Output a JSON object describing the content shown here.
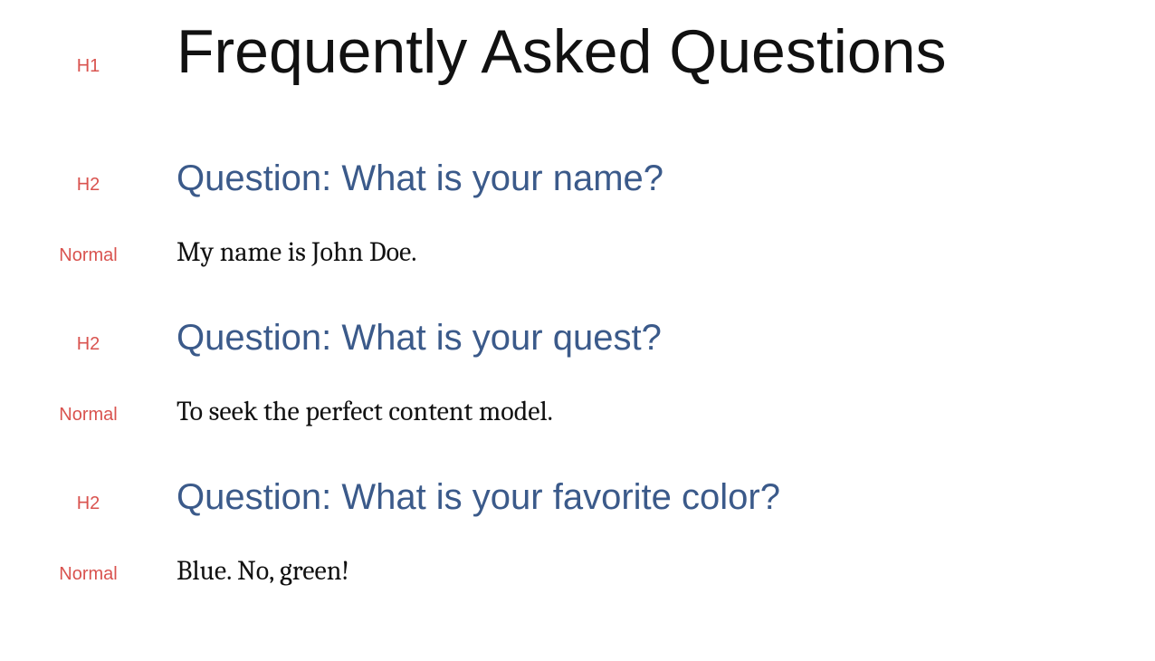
{
  "labels": {
    "h1": "H1",
    "h2": "H2",
    "normal": "Normal"
  },
  "title": "Frequently Asked Questions",
  "faq": [
    {
      "question": "Question: What is your name?",
      "answer": "My name is John Doe."
    },
    {
      "question": "Question: What is your quest?",
      "answer": "To seek the perfect content model."
    },
    {
      "question": "Question: What is your favorite color?",
      "answer": "Blue. No, green!"
    }
  ]
}
